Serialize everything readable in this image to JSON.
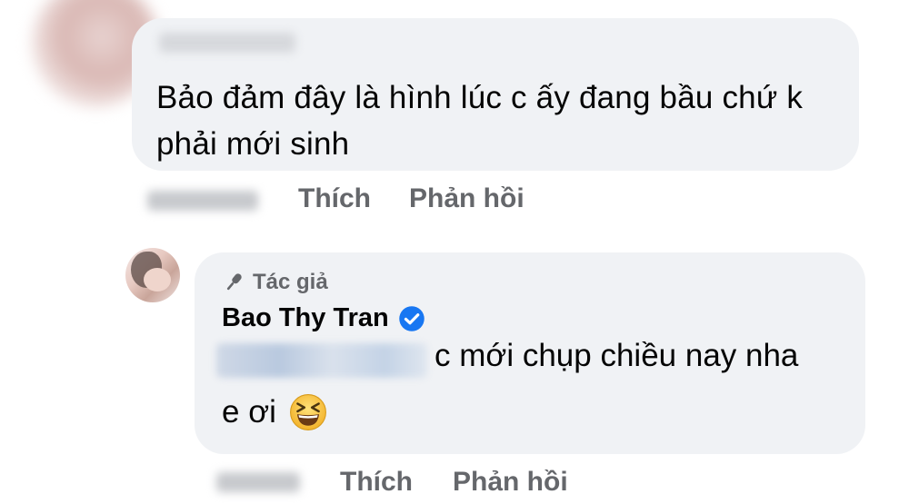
{
  "comment1": {
    "text": "Bảo đảm đây là hình lúc c ấy đang bầu chứ k phải mới sinh",
    "like_label": "Thích",
    "reply_label": "Phản hồi"
  },
  "comment2": {
    "author_badge": "Tác giả",
    "author_name": "Bao Thy Tran",
    "text_line1": "c mới chụp chiều nay nha",
    "text_line2": "e ơi",
    "like_label": "Thích",
    "reply_label": "Phản hồi"
  },
  "icons": {
    "author_badge_icon": "microphone-icon",
    "verified_icon": "verified-check-icon",
    "emoji": "laughing-squint-emoji"
  },
  "colors": {
    "bubble": "#f0f2f5",
    "action_text": "#65676b",
    "verified": "#1877f2"
  }
}
